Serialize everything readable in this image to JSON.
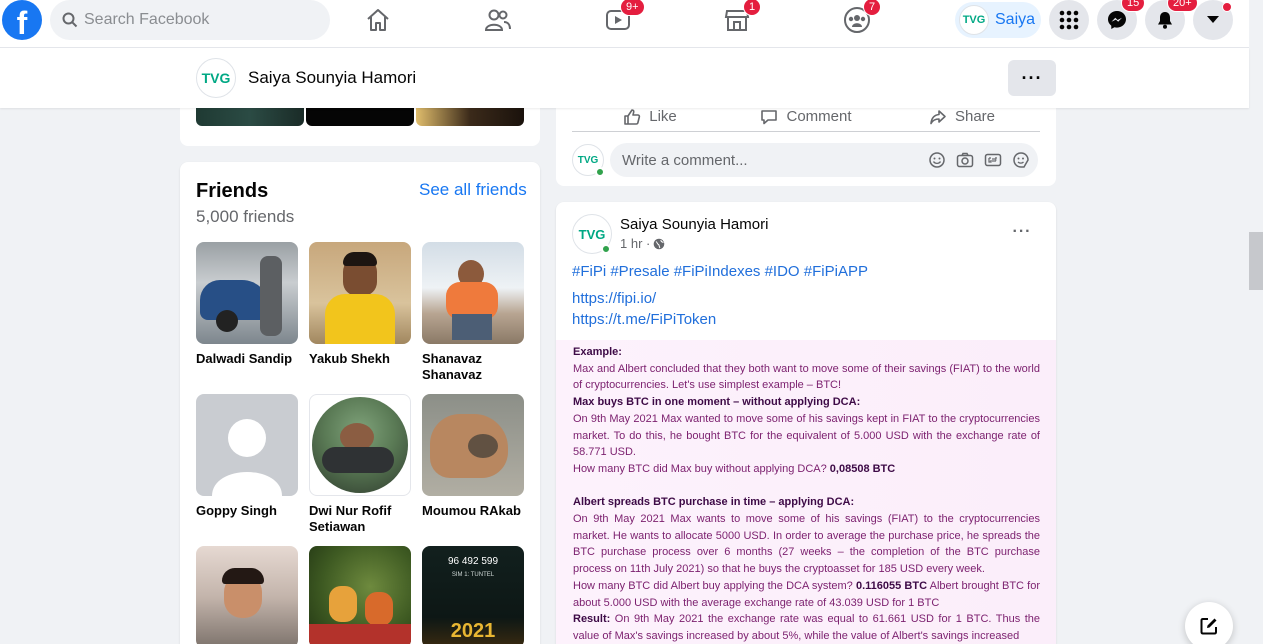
{
  "topbar": {
    "search_placeholder": "Search Facebook",
    "logo_letter": "f",
    "badges": {
      "watch": "9+",
      "marketplace": "1",
      "groups": "7",
      "messenger": "15",
      "notifications": "20+"
    },
    "profile_name": "Saiya"
  },
  "profile_header": {
    "name": "Saiya Sounyia Hamori",
    "more": "···",
    "avatar_text": "TVG"
  },
  "friends": {
    "title": "Friends",
    "count": "5,000 friends",
    "see_all": "See all friends",
    "items": [
      {
        "name": "Dalwadi Sandip"
      },
      {
        "name": "Yakub Shekh"
      },
      {
        "name": "Shanavaz Shanavaz"
      },
      {
        "name": "Goppy Singh"
      },
      {
        "name": "Dwi Nur Rofif Setiawan"
      },
      {
        "name": "Moumou RAkab"
      },
      {
        "name": ""
      },
      {
        "name": ""
      },
      {
        "name": ""
      }
    ],
    "photo_overlay_text": "96 492 599",
    "photo_overlay_sub": "SIM 1: TUNTEL",
    "photo_year": "2021"
  },
  "post_actions": {
    "like": "Like",
    "comment": "Comment",
    "share": "Share",
    "comment_placeholder": "Write a comment..."
  },
  "post": {
    "author": "Saiya Sounyia Hamori",
    "time": "1 hr ·",
    "more": "···",
    "hashtags": "#FiPi #Presale #FiPiIndexes #IDO #FiPiAPP",
    "links": [
      "https://fipi.io/",
      "https://t.me/FiPiToken"
    ],
    "image_text": {
      "example_heading": "Example:",
      "p1": "Max and Albert concluded that they both want to move some of their savings (FIAT) to the world of cryptocurrencies. Let's use simplest example – BTC!",
      "h2": "Max buys BTC in one moment – without applying DCA:",
      "p2": "On 9th May 2021 Max wanted to move some of his savings kept in FIAT to the cryptocurrencies market. To do this, he bought BTC for the equivalent of 5.000 USD with the exchange rate of 58.771 USD.",
      "q1": "How many BTC did Max buy without applying DCA?",
      "q1_answer": "0,08508 BTC",
      "h3": "Albert spreads BTC purchase in time – applying DCA:",
      "p3": "On 9th May 2021 Max wants to move some of his savings (FIAT) to the cryptocurrencies market. He wants to allocate 5000 USD. In order to average the purchase price, he spreads the BTC purchase process over 6 months (27 weeks – the completion of the BTC purchase process on 11th July 2021) so that he buys the cryptoasset for 185 USD every week.",
      "q2": "How many BTC did Albert buy applying the DCA system?",
      "q2_answer": "0.116055 BTC",
      "q2_rest": "Albert brought BTC for about 5.000 USD with the average exchange rate of 43.039 USD for 1 BTC",
      "result_label": "Result:",
      "result": "On 9th May 2021 the exchange rate was equal to 61.661 USD for 1 BTC. Thus the value of Max's savings increased by about 5%, while the value of Albert's savings increased"
    }
  }
}
